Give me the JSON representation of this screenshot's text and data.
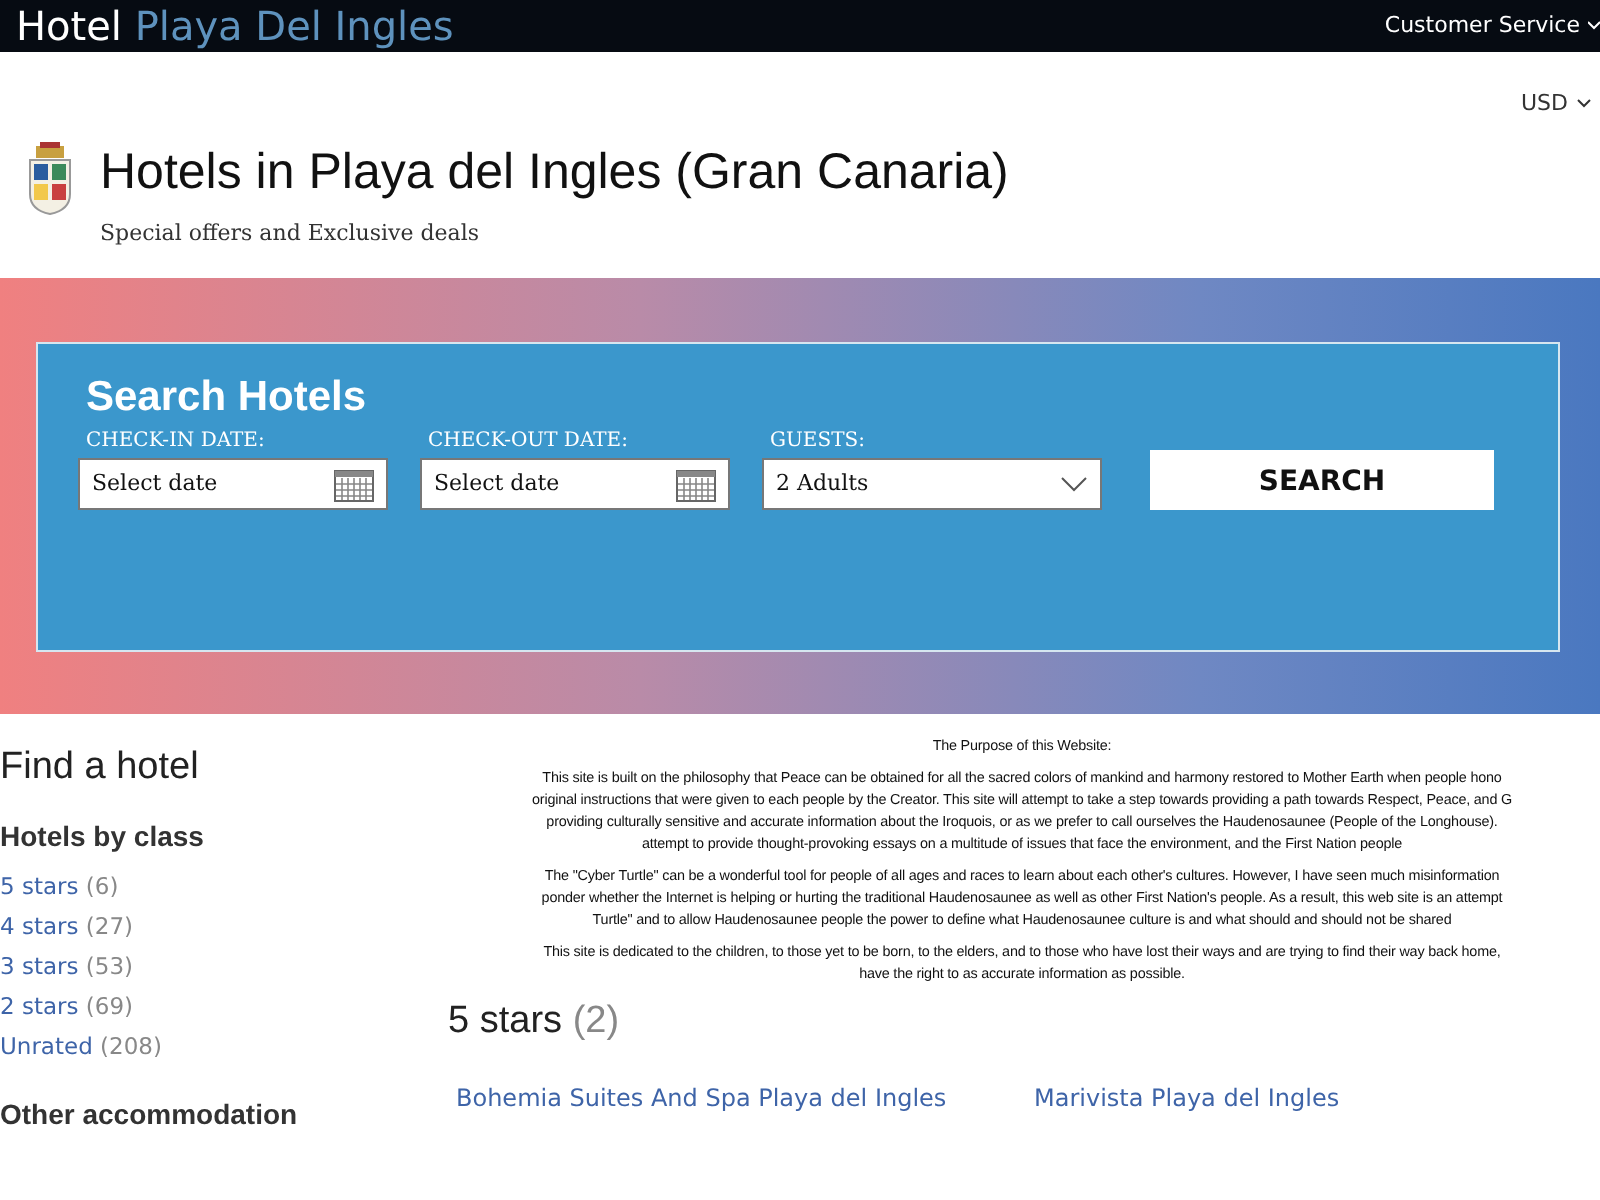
{
  "topbar": {
    "brand_first": "Hotel",
    "brand_second": "Playa Del Ingles",
    "menu": "Customer Service"
  },
  "currency": "USD",
  "header": {
    "title": "Hotels in Playa del Ingles (Gran Canaria)",
    "subtitle": "Special offers and Exclusive deals"
  },
  "search": {
    "title": "Search Hotels",
    "fields": [
      {
        "kind": "date",
        "label": "CHECK-IN DATE:",
        "value": "Select date"
      },
      {
        "kind": "date",
        "label": "CHECK-OUT DATE:",
        "value": "Select date"
      },
      {
        "kind": "select",
        "label": "GUESTS:",
        "value": "2 Adults"
      }
    ],
    "button": "SEARCH"
  },
  "sidebar": {
    "title": "Find a hotel",
    "sections": [
      {
        "title": "Hotels by class",
        "items": [
          {
            "label": "5 stars",
            "count": "(6)"
          },
          {
            "label": "4 stars",
            "count": "(27)"
          },
          {
            "label": "3 stars",
            "count": "(53)"
          },
          {
            "label": "2 stars",
            "count": "(69)"
          },
          {
            "label": "Unrated",
            "count": "(208)"
          }
        ]
      },
      {
        "title": "Other accommodation"
      }
    ]
  },
  "purpose": {
    "heading": "The Purpose of this Website:",
    "paragraphs": [
      [
        "This site is built on the philosophy that Peace can be obtained for all the sacred colors of mankind and harmony restored to Mother Earth when people hono",
        "original instructions that were given to each people by the Creator. This site will attempt to take a step towards providing a path towards Respect, Peace, and G",
        "providing culturally sensitive and accurate information about the Iroquois, or as we prefer to call ourselves the Haudenosaunee (People of the Longhouse).",
        "attempt to provide thought-provoking essays on a multitude of issues that face the environment, and the First Nation people"
      ],
      [
        "The \"Cyber Turtle\" can be a wonderful tool for people of all ages and races to learn about each other's cultures. However, I have seen much misinformation",
        "ponder whether the Internet is helping or hurting the traditional Haudenosaunee as well as other First Nation's people. As a result, this web site is an attempt",
        "Turtle\" and to allow Haudenosaunee people the power to define what Haudenosaunee culture is and what should and should not be shared"
      ],
      [
        "This site is dedicated to the children, to those yet to be born, to the elders, and to those who have lost their ways and are trying to find their way back home,",
        "have the right to as accurate information as possible."
      ]
    ]
  },
  "results": {
    "title": "5 stars",
    "count": "(2)",
    "hotels": [
      "Bohemia Suites And Spa Playa del Ingles",
      "Marivista Playa del Ingles"
    ]
  }
}
